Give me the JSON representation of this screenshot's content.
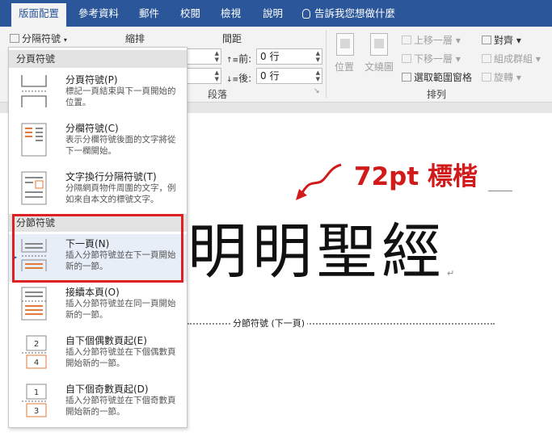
{
  "tabs": [
    {
      "label": "版面配置",
      "active": true
    },
    {
      "label": "參考資料",
      "active": false
    },
    {
      "label": "郵件",
      "active": false
    },
    {
      "label": "校閱",
      "active": false
    },
    {
      "label": "檢視",
      "active": false
    },
    {
      "label": "說明",
      "active": false
    }
  ],
  "tell_me": "告訴我您想做什麼",
  "ribbon": {
    "breaks_button": "分隔符號",
    "indent_label": "縮排",
    "spacing_label": "間距",
    "before_label": "前:",
    "before_value": "0 行",
    "after_label": "後:",
    "after_value": "0 行",
    "paragraph_group": "段落",
    "position_label": "位置",
    "wrap_label": "文繞圖",
    "bring_forward": "上移一層",
    "send_backward": "下移一層",
    "selection_pane": "選取範圍窗格",
    "align": "對齊",
    "group": "組成群組",
    "rotate": "旋轉",
    "arrange_group": "排列"
  },
  "menu": {
    "page_breaks_header": "分頁符號",
    "section_breaks_header": "分節符號",
    "items": [
      {
        "title": "分頁符號(P)",
        "desc": "標記一頁結束與下一頁開始的位置。"
      },
      {
        "title": "分欄符號(C)",
        "desc": "表示分欄符號後面的文字將從下一欄開始。"
      },
      {
        "title": "文字換行分隔符號(T)",
        "desc": "分隔網頁物件周圍的文字，例如來自本文的標號文字。"
      },
      {
        "title": "下一頁(N)",
        "desc": "插入分節符號並在下一頁開始新的一節。"
      },
      {
        "title": "接續本頁(O)",
        "desc": "插入分節符號並在同一頁開始新的一節。"
      },
      {
        "title": "自下個偶數頁起(E)",
        "desc": "插入分節符號並在下個偶數頁開始新的一節。"
      },
      {
        "title": "自下個奇數頁起(D)",
        "desc": "插入分節符號並在下個奇數頁開始新的一節。"
      }
    ]
  },
  "document": {
    "big_text": "明明聖經",
    "section_break": "分節符號 (下一頁)",
    "annotation": "72pt 標楷"
  },
  "colors": {
    "ribbon_blue": "#2b579a",
    "annotation_red": "#d11a1a",
    "highlight_red": "#e02020"
  }
}
